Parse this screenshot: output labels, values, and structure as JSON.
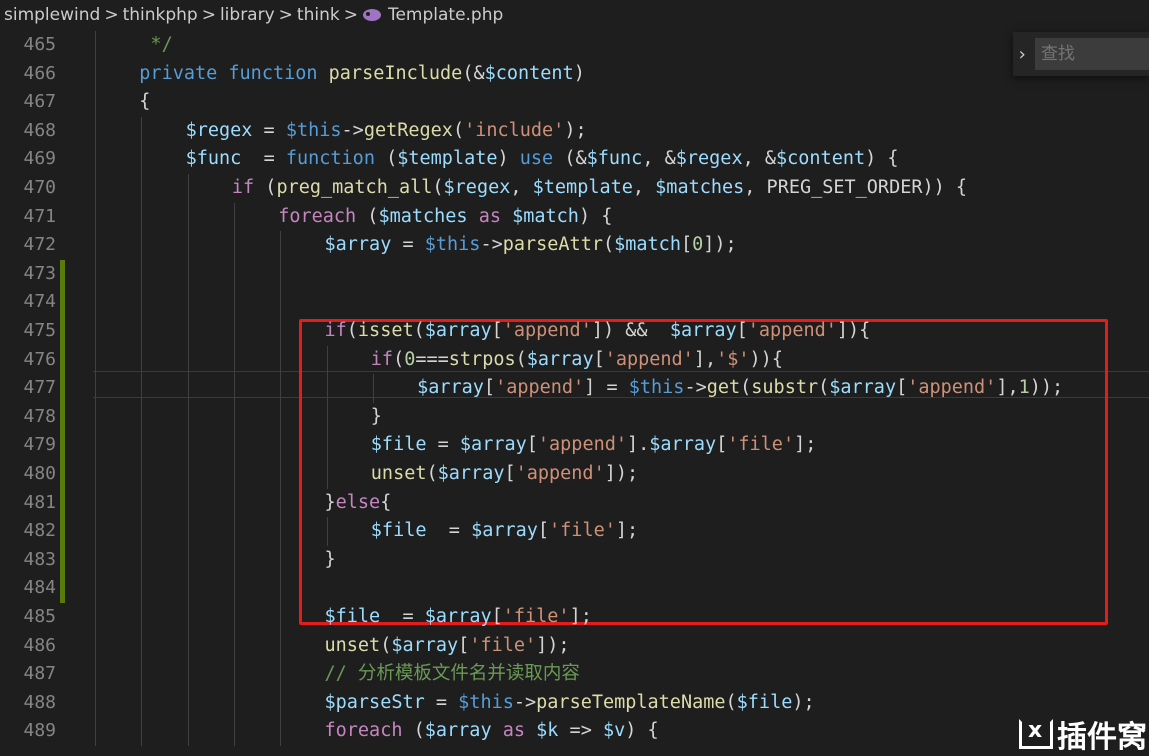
{
  "breadcrumb": {
    "items": [
      "simplewind",
      "thinkphp",
      "library",
      "think"
    ],
    "separator": ">",
    "file_icon": "php-elephant-icon",
    "file_name": "Template.php"
  },
  "find_widget": {
    "toggle_icon": "chevron-right-icon",
    "placeholder": "查找"
  },
  "colors": {
    "keyword": "#569cd6",
    "control": "#c586c0",
    "variable": "#9cdcfe",
    "function": "#dcdcaa",
    "string": "#ce9178",
    "number": "#b5cea8",
    "comment": "#6a9955",
    "highlight_box": "#e51c1c",
    "modified_gutter": "#587c0c"
  },
  "code": {
    "lines": [
      {
        "n": "465",
        "indent": 1,
        "modified": false,
        "toks": [
          [
            "cmt",
            " */"
          ]
        ]
      },
      {
        "n": "466",
        "indent": 1,
        "modified": false,
        "toks": [
          [
            "kw",
            "private"
          ],
          [
            "t",
            " "
          ],
          [
            "kw",
            "function"
          ],
          [
            "t",
            " "
          ],
          [
            "fn",
            "parseInclude"
          ],
          [
            "t",
            "(&"
          ],
          [
            "var",
            "$content"
          ],
          [
            "t",
            ")"
          ]
        ]
      },
      {
        "n": "467",
        "indent": 1,
        "modified": false,
        "toks": [
          [
            "t",
            "{"
          ]
        ]
      },
      {
        "n": "468",
        "indent": 2,
        "modified": false,
        "toks": [
          [
            "var",
            "$regex"
          ],
          [
            "t",
            " = "
          ],
          [
            "kw",
            "$this"
          ],
          [
            "t",
            "->"
          ],
          [
            "fn",
            "getRegex"
          ],
          [
            "t",
            "("
          ],
          [
            "str",
            "'include'"
          ],
          [
            "t",
            ");"
          ]
        ]
      },
      {
        "n": "469",
        "indent": 2,
        "modified": false,
        "toks": [
          [
            "var",
            "$func"
          ],
          [
            "t",
            "  = "
          ],
          [
            "kw",
            "function"
          ],
          [
            "t",
            " ("
          ],
          [
            "var",
            "$template"
          ],
          [
            "t",
            ") "
          ],
          [
            "kw",
            "use"
          ],
          [
            "t",
            " (&"
          ],
          [
            "var",
            "$func"
          ],
          [
            "t",
            ", &"
          ],
          [
            "var",
            "$regex"
          ],
          [
            "t",
            ", &"
          ],
          [
            "var",
            "$content"
          ],
          [
            "t",
            ") {"
          ]
        ]
      },
      {
        "n": "470",
        "indent": 3,
        "modified": false,
        "toks": [
          [
            "ctl",
            "if"
          ],
          [
            "t",
            " ("
          ],
          [
            "fn",
            "preg_match_all"
          ],
          [
            "t",
            "("
          ],
          [
            "var",
            "$regex"
          ],
          [
            "t",
            ", "
          ],
          [
            "var",
            "$template"
          ],
          [
            "t",
            ", "
          ],
          [
            "var",
            "$matches"
          ],
          [
            "t",
            ", PREG_SET_ORDER)) {"
          ]
        ]
      },
      {
        "n": "471",
        "indent": 4,
        "modified": false,
        "toks": [
          [
            "ctl",
            "foreach"
          ],
          [
            "t",
            " ("
          ],
          [
            "var",
            "$matches"
          ],
          [
            "t",
            " "
          ],
          [
            "ctl",
            "as"
          ],
          [
            "t",
            " "
          ],
          [
            "var",
            "$match"
          ],
          [
            "t",
            ") {"
          ]
        ]
      },
      {
        "n": "472",
        "indent": 5,
        "modified": false,
        "toks": [
          [
            "var",
            "$array"
          ],
          [
            "t",
            " = "
          ],
          [
            "kw",
            "$this"
          ],
          [
            "t",
            "->"
          ],
          [
            "fn",
            "parseAttr"
          ],
          [
            "t",
            "("
          ],
          [
            "var",
            "$match"
          ],
          [
            "t",
            "["
          ],
          [
            "num",
            "0"
          ],
          [
            "t",
            "]);"
          ]
        ]
      },
      {
        "n": "473",
        "indent": 5,
        "modified": true,
        "toks": []
      },
      {
        "n": "474",
        "indent": 5,
        "modified": true,
        "toks": []
      },
      {
        "n": "475",
        "indent": 5,
        "modified": true,
        "toks": [
          [
            "ctl",
            "if"
          ],
          [
            "t",
            "("
          ],
          [
            "fn",
            "isset"
          ],
          [
            "t",
            "("
          ],
          [
            "var",
            "$array"
          ],
          [
            "t",
            "["
          ],
          [
            "str",
            "'append'"
          ],
          [
            "t",
            "]) &&  "
          ],
          [
            "var",
            "$array"
          ],
          [
            "t",
            "["
          ],
          [
            "str",
            "'append'"
          ],
          [
            "t",
            "]){"
          ]
        ]
      },
      {
        "n": "476",
        "indent": 6,
        "modified": true,
        "toks": [
          [
            "ctl",
            "if"
          ],
          [
            "t",
            "("
          ],
          [
            "num",
            "0"
          ],
          [
            "t",
            "==="
          ],
          [
            "fn",
            "strpos"
          ],
          [
            "t",
            "("
          ],
          [
            "var",
            "$array"
          ],
          [
            "t",
            "["
          ],
          [
            "str",
            "'append'"
          ],
          [
            "t",
            "],"
          ],
          [
            "str",
            "'$'"
          ],
          [
            "t",
            "))"
          ],
          [
            "t",
            "{"
          ]
        ]
      },
      {
        "n": "477",
        "indent": 7,
        "modified": true,
        "toks": [
          [
            "var",
            "$array"
          ],
          [
            "t",
            "["
          ],
          [
            "str",
            "'append'"
          ],
          [
            "t",
            "] = "
          ],
          [
            "kw",
            "$this"
          ],
          [
            "t",
            "->"
          ],
          [
            "fn",
            "get"
          ],
          [
            "t",
            "("
          ],
          [
            "fn",
            "substr"
          ],
          [
            "t",
            "("
          ],
          [
            "var",
            "$array"
          ],
          [
            "t",
            "["
          ],
          [
            "str",
            "'append'"
          ],
          [
            "t",
            "],"
          ],
          [
            "num",
            "1"
          ],
          [
            "t",
            "));"
          ]
        ]
      },
      {
        "n": "478",
        "indent": 6,
        "modified": true,
        "toks": [
          [
            "t",
            "}"
          ]
        ]
      },
      {
        "n": "479",
        "indent": 6,
        "modified": true,
        "toks": [
          [
            "var",
            "$file"
          ],
          [
            "t",
            " = "
          ],
          [
            "var",
            "$array"
          ],
          [
            "t",
            "["
          ],
          [
            "str",
            "'append'"
          ],
          [
            "t",
            "]."
          ],
          [
            "var",
            "$array"
          ],
          [
            "t",
            "["
          ],
          [
            "str",
            "'file'"
          ],
          [
            "t",
            "];"
          ]
        ]
      },
      {
        "n": "480",
        "indent": 6,
        "modified": true,
        "toks": [
          [
            "fn",
            "unset"
          ],
          [
            "t",
            "("
          ],
          [
            "var",
            "$array"
          ],
          [
            "t",
            "["
          ],
          [
            "str",
            "'append'"
          ],
          [
            "t",
            "]);"
          ]
        ]
      },
      {
        "n": "481",
        "indent": 5,
        "modified": true,
        "toks": [
          [
            "t",
            "}"
          ],
          [
            "ctl",
            "else"
          ],
          [
            "t",
            "{"
          ]
        ]
      },
      {
        "n": "482",
        "indent": 6,
        "modified": true,
        "toks": [
          [
            "var",
            "$file"
          ],
          [
            "t",
            "  = "
          ],
          [
            "var",
            "$array"
          ],
          [
            "t",
            "["
          ],
          [
            "str",
            "'file'"
          ],
          [
            "t",
            "];"
          ]
        ]
      },
      {
        "n": "483",
        "indent": 5,
        "modified": true,
        "toks": [
          [
            "t",
            "}"
          ]
        ]
      },
      {
        "n": "484",
        "indent": 5,
        "modified": true,
        "toks": []
      },
      {
        "n": "485",
        "indent": 5,
        "modified": false,
        "toks": [
          [
            "var",
            "$file"
          ],
          [
            "t",
            "  = "
          ],
          [
            "var",
            "$array"
          ],
          [
            "t",
            "["
          ],
          [
            "str",
            "'file'"
          ],
          [
            "t",
            "];"
          ]
        ]
      },
      {
        "n": "486",
        "indent": 5,
        "modified": false,
        "toks": [
          [
            "fn",
            "unset"
          ],
          [
            "t",
            "("
          ],
          [
            "var",
            "$array"
          ],
          [
            "t",
            "["
          ],
          [
            "str",
            "'file'"
          ],
          [
            "t",
            "]);"
          ]
        ]
      },
      {
        "n": "487",
        "indent": 5,
        "modified": false,
        "toks": [
          [
            "cmt",
            "// 分析模板文件名并读取内容"
          ]
        ]
      },
      {
        "n": "488",
        "indent": 5,
        "modified": false,
        "toks": [
          [
            "var",
            "$parseStr"
          ],
          [
            "t",
            " = "
          ],
          [
            "kw",
            "$this"
          ],
          [
            "t",
            "->"
          ],
          [
            "fn",
            "parseTemplateName"
          ],
          [
            "t",
            "("
          ],
          [
            "var",
            "$file"
          ],
          [
            "t",
            ");"
          ]
        ]
      },
      {
        "n": "489",
        "indent": 5,
        "modified": false,
        "toks": [
          [
            "ctl",
            "foreach"
          ],
          [
            "t",
            " ("
          ],
          [
            "var",
            "$array"
          ],
          [
            "t",
            " "
          ],
          [
            "ctl",
            "as"
          ],
          [
            "t",
            " "
          ],
          [
            "var",
            "$k"
          ],
          [
            "t",
            " => "
          ],
          [
            "var",
            "$v"
          ],
          [
            "t",
            ") {"
          ]
        ]
      }
    ]
  },
  "watermark": {
    "icon": "brackets-x-logo-icon",
    "text": "插件窝"
  }
}
